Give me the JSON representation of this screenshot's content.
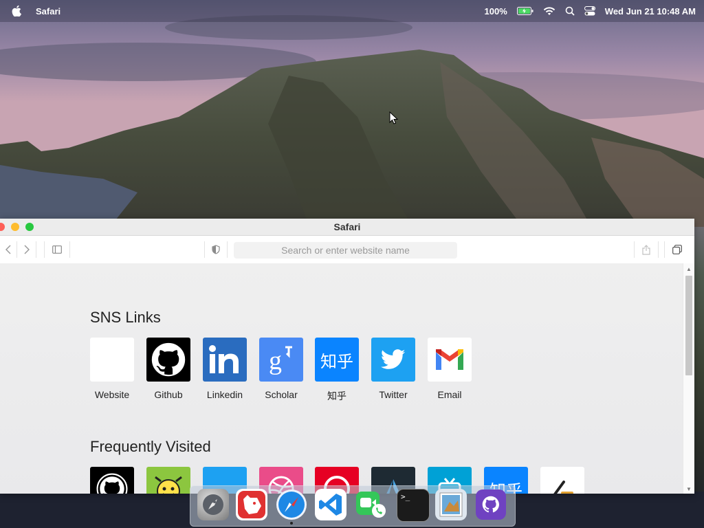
{
  "menubar": {
    "app_name": "Safari",
    "battery": "100%",
    "datetime": "Wed Jun 21 10:48 AM"
  },
  "window": {
    "title": "Safari",
    "address_placeholder": "Search or enter website name"
  },
  "sections": {
    "sns_title": "SNS Links",
    "frequent_title": "Frequently Visited"
  },
  "sns_links": [
    {
      "label": "Website",
      "icon": "website-icon",
      "color": "#ffffff"
    },
    {
      "label": "Github",
      "icon": "github-icon",
      "color": "#000000"
    },
    {
      "label": "Linkedin",
      "icon": "linkedin-icon",
      "color": "#2a6cbf"
    },
    {
      "label": "Scholar",
      "icon": "scholar-icon",
      "color": "#4a8af4"
    },
    {
      "label": "知乎",
      "icon": "zhihu-icon",
      "color": "#0a84ff"
    },
    {
      "label": "Twitter",
      "icon": "twitter-icon",
      "color": "#1da1f2"
    },
    {
      "label": "Email",
      "icon": "gmail-icon",
      "color": "#ffffff"
    }
  ],
  "frequent_icons": [
    {
      "icon": "github-icon",
      "color": "#000000"
    },
    {
      "icon": "smiley-icon",
      "color": "#8cc63f"
    },
    {
      "icon": "twitter-icon",
      "color": "#1da1f2"
    },
    {
      "icon": "dribbble-icon",
      "color": "#ea4c89"
    },
    {
      "icon": "pinterest-icon",
      "color": "#e60023"
    },
    {
      "icon": "vscode-icon",
      "color": "#1e2a33"
    },
    {
      "icon": "bilibili-icon",
      "color": "#00a1d6"
    },
    {
      "icon": "zhihu-icon",
      "color": "#0a84ff"
    },
    {
      "icon": "pen-icon",
      "color": "#ffffff"
    }
  ],
  "dock": [
    {
      "icon": "launchpad-icon"
    },
    {
      "icon": "bear-icon"
    },
    {
      "icon": "safari-icon"
    },
    {
      "icon": "vscode-icon"
    },
    {
      "icon": "facetime-icon"
    },
    {
      "icon": "terminal-icon",
      "label": ">_"
    },
    {
      "icon": "preview-icon"
    },
    {
      "icon": "github-icon"
    }
  ]
}
